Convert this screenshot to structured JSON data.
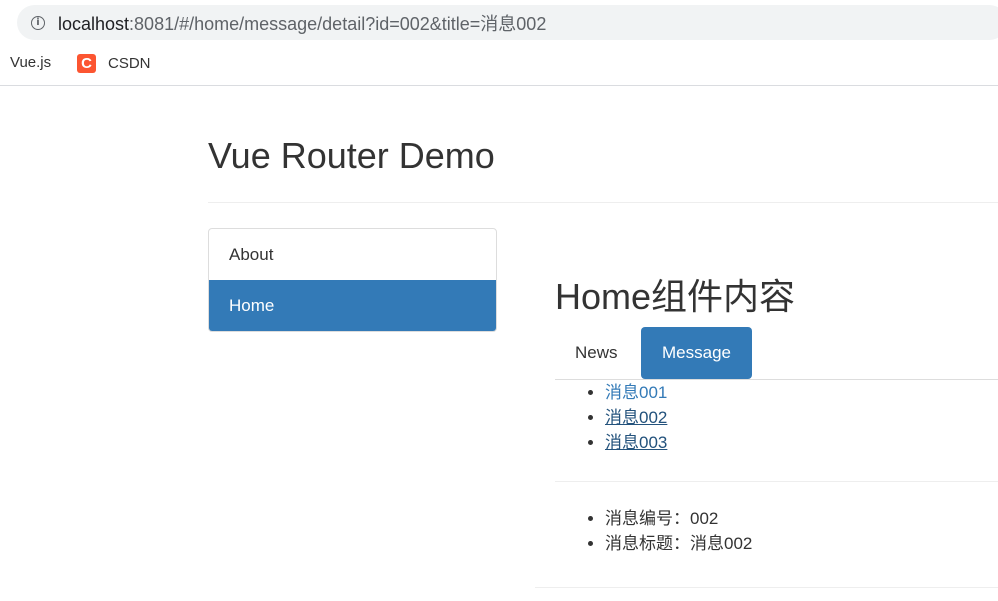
{
  "browser": {
    "url_host": "localhost",
    "url_rest": ":8081/#/home/message/detail?id=002&title=消息002",
    "bookmarks": [
      {
        "label": "Vue.js"
      },
      {
        "label": "CSDN",
        "icon_letter": "C"
      }
    ]
  },
  "page": {
    "title": "Vue Router Demo"
  },
  "sidebar": {
    "items": [
      {
        "label": "About",
        "active": false
      },
      {
        "label": "Home",
        "active": true
      }
    ]
  },
  "home": {
    "heading": "Home组件内容",
    "tabs": [
      {
        "label": "News",
        "active": false
      },
      {
        "label": "Message",
        "active": true
      }
    ]
  },
  "messages": {
    "items": [
      {
        "label": "消息001"
      },
      {
        "label": "消息002"
      },
      {
        "label": "消息003"
      }
    ]
  },
  "detail": {
    "id_line": "消息编号：002",
    "title_line": "消息标题：消息002"
  },
  "colors": {
    "primary": "#337ab7",
    "csdn": "#fc5531"
  }
}
